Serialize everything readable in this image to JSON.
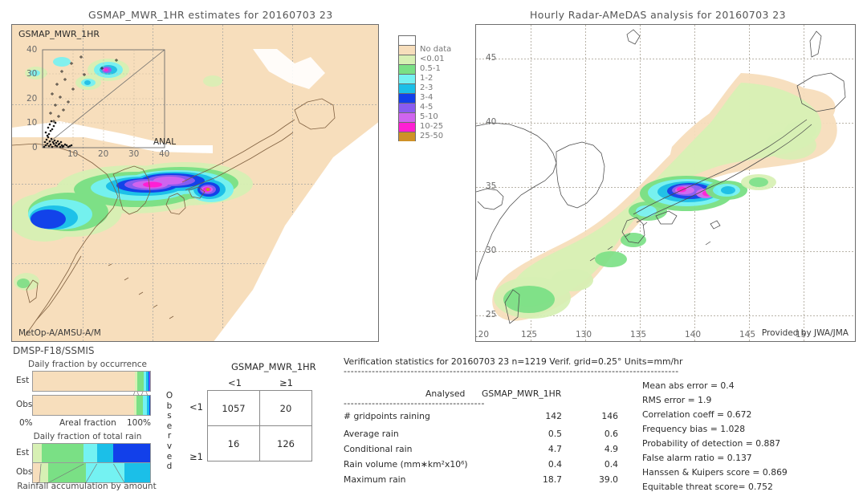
{
  "left_panel": {
    "title": "GSMAP_MWR_1HR estimates for 20160703 23",
    "corner_tag": "GSMAP_MWR_1HR",
    "credit": "MetOp-A/AMSU-A/M",
    "scatter_inset": {
      "y_axis_label": "GSMAP_MWR_1HR",
      "x_axis_label": "ANAL",
      "y_ticks": [
        "0",
        "10",
        "20",
        "30",
        "40"
      ],
      "x_ticks": [
        "0",
        "10",
        "20",
        "30",
        "40"
      ]
    }
  },
  "right_panel": {
    "title": "Hourly Radar-AMeDAS analysis for 20160703 23",
    "credit": "Provided by JWA/JMA",
    "lat_ticks": [
      "45",
      "40",
      "35",
      "30",
      "25"
    ],
    "lon_ticks": [
      "120",
      "125",
      "130",
      "135",
      "140",
      "145",
      "15"
    ]
  },
  "colorbar": {
    "labels": [
      "No data",
      "<0.01",
      "0.5-1",
      "1-2",
      "2-3",
      "3-4",
      "4-5",
      "5-10",
      "10-25",
      "25-50"
    ],
    "colors": [
      "#ffffff",
      "#f7debc",
      "#d7f0b4",
      "#7ae085",
      "#74f2f2",
      "#1bbfe8",
      "#1240ea",
      "#8a5cf0",
      "#d065ef",
      "#ff1fd4",
      "#cf9127"
    ]
  },
  "occurrence_chart": {
    "sensor": "DMSP-F18/SSMIS",
    "title": "Daily fraction by occurrence",
    "axis_left": "0%",
    "axis_center": "Areal fraction",
    "axis_right": "100%",
    "rows": [
      {
        "label": "Est",
        "segments": [
          {
            "color": "#f7debc",
            "pct": 87.0
          },
          {
            "color": "#d7f0b4",
            "pct": 2.2
          },
          {
            "color": "#7ae085",
            "pct": 5.0
          },
          {
            "color": "#74f2f2",
            "pct": 2.6
          },
          {
            "color": "#1bbfe8",
            "pct": 1.6
          },
          {
            "color": "#1240ea",
            "pct": 1.0
          },
          {
            "color": "#8a5cf0",
            "pct": 0.6
          }
        ]
      },
      {
        "label": "Obs",
        "segments": [
          {
            "color": "#f7debc",
            "pct": 86.5
          },
          {
            "color": "#d7f0b4",
            "pct": 2.0
          },
          {
            "color": "#7ae085",
            "pct": 5.5
          },
          {
            "color": "#74f2f2",
            "pct": 3.2
          },
          {
            "color": "#1bbfe8",
            "pct": 1.8
          },
          {
            "color": "#1240ea",
            "pct": 1.0
          }
        ]
      }
    ]
  },
  "total_rain_chart": {
    "title": "Daily fraction of total rain",
    "caption": "Rainfall accumulation by amount",
    "rows": [
      {
        "label": "Est",
        "segments": [
          {
            "color": "#d7f0b4",
            "pct": 7.5
          },
          {
            "color": "#7ae085",
            "pct": 36.0
          },
          {
            "color": "#74f2f2",
            "pct": 11.0
          },
          {
            "color": "#1bbfe8",
            "pct": 14.0
          },
          {
            "color": "#1240ea",
            "pct": 31.5
          }
        ]
      },
      {
        "label": "Obs",
        "segments": [
          {
            "color": "#f7debc",
            "pct": 6.0
          },
          {
            "color": "#d7f0b4",
            "pct": 7.0
          },
          {
            "color": "#7ae085",
            "pct": 32.0
          },
          {
            "color": "#74f2f2",
            "pct": 33.0
          },
          {
            "color": "#1bbfe8",
            "pct": 22.0
          }
        ]
      }
    ]
  },
  "contingency": {
    "title": "GSMAP_MWR_1HR",
    "col_headers": [
      "<1",
      "≥1"
    ],
    "row_headers": [
      "<1",
      "≥1"
    ],
    "side_label": "Observed",
    "cells": [
      [
        "1057",
        "20"
      ],
      [
        "16",
        "126"
      ]
    ]
  },
  "verification": {
    "header": "Verification statistics for 20160703 23  n=1219  Verif. grid=0.25°  Units=mm/hr",
    "col_headers": [
      "Analysed",
      "GSMAP_MWR_1HR"
    ],
    "rows": [
      {
        "label": "# gridpoints raining",
        "analysed": "142",
        "estimate": "146"
      },
      {
        "label": "Average rain",
        "analysed": "0.5",
        "estimate": "0.6"
      },
      {
        "label": "Conditional rain",
        "analysed": "4.7",
        "estimate": "4.9"
      },
      {
        "label": "Rain volume (mm∗km²x10⁶)",
        "analysed": "0.4",
        "estimate": "0.4"
      },
      {
        "label": "Maximum rain",
        "analysed": "18.7",
        "estimate": "39.0"
      }
    ],
    "metrics": [
      "Mean abs error = 0.4",
      "RMS error = 1.9",
      "Correlation coeff = 0.672",
      "Frequency bias = 1.028",
      "Probability of detection = 0.887",
      "False alarm ratio = 0.137",
      "Hanssen & Kuipers score = 0.869",
      "Equitable threat score= 0.752"
    ]
  }
}
